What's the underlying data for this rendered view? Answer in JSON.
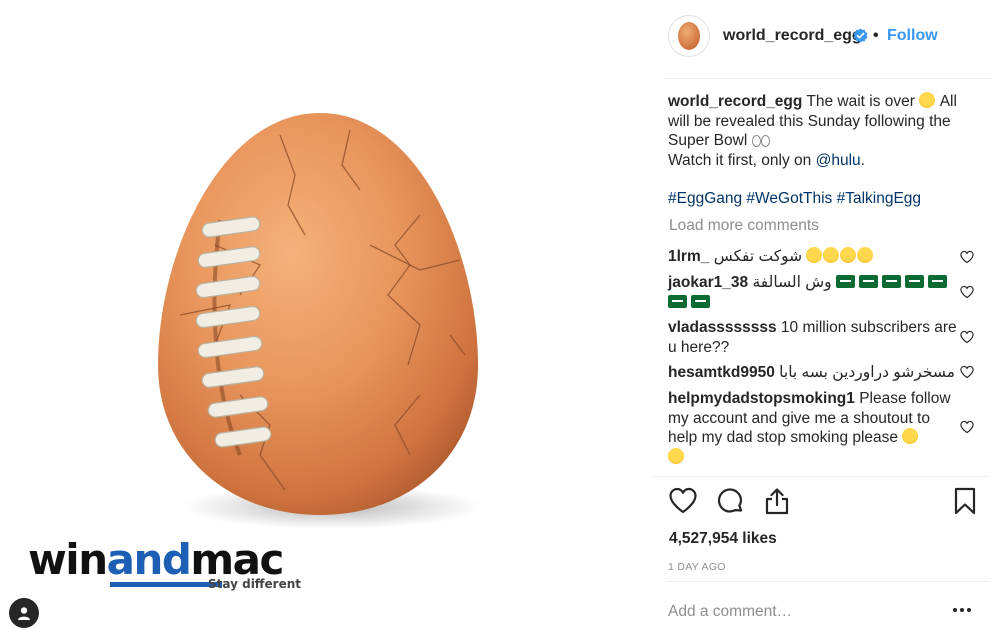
{
  "post": {
    "username": "world_record_egg",
    "follow_label": "Follow",
    "separator": "•",
    "caption": {
      "username": "world_record_egg",
      "text_part1": "The wait is over",
      "text_part2": "All will be revealed this Sunday following the Super Bowl",
      "text_part3": "Watch it first, only on",
      "mention": "@hulu",
      "text_end": ".",
      "hashtags": "#EggGang #WeGotThis #TalkingEgg"
    },
    "load_more_label": "Load more comments",
    "comments": [
      {
        "username": "1lrm_",
        "text": "شوكت تفكس"
      },
      {
        "username": "jaokar1_38",
        "text": "وش السالفة"
      },
      {
        "username": "vladassssssss",
        "text": "10 million subscribers are u here??"
      },
      {
        "username": "hesamtkd9950",
        "text": "مسخرشو دراوردین بسه بابا"
      },
      {
        "username": "helpmydadstopsmoking1",
        "text": "Please follow my account and give me a shoutout to help my dad stop smoking please"
      }
    ],
    "likes": "4,527,954 likes",
    "timestamp": "1 DAY AGO",
    "comment_placeholder": "Add a comment…"
  },
  "watermark": {
    "part1": "win",
    "part2": "and",
    "part3": "mac",
    "tagline": "Stay different"
  },
  "colors": {
    "link_blue": "#3897f0",
    "hashtag_navy": "#003569",
    "muted_gray": "#8e8e8e",
    "egg_orange": "#e8955c",
    "watermark_blue": "#1d5fb4"
  },
  "icons": {
    "verified": "verified-badge-icon",
    "heart": "heart-icon",
    "comment": "comment-bubble-icon",
    "share": "share-icon",
    "save": "bookmark-icon",
    "more": "more-options-icon",
    "tagged": "user-tag-icon"
  }
}
